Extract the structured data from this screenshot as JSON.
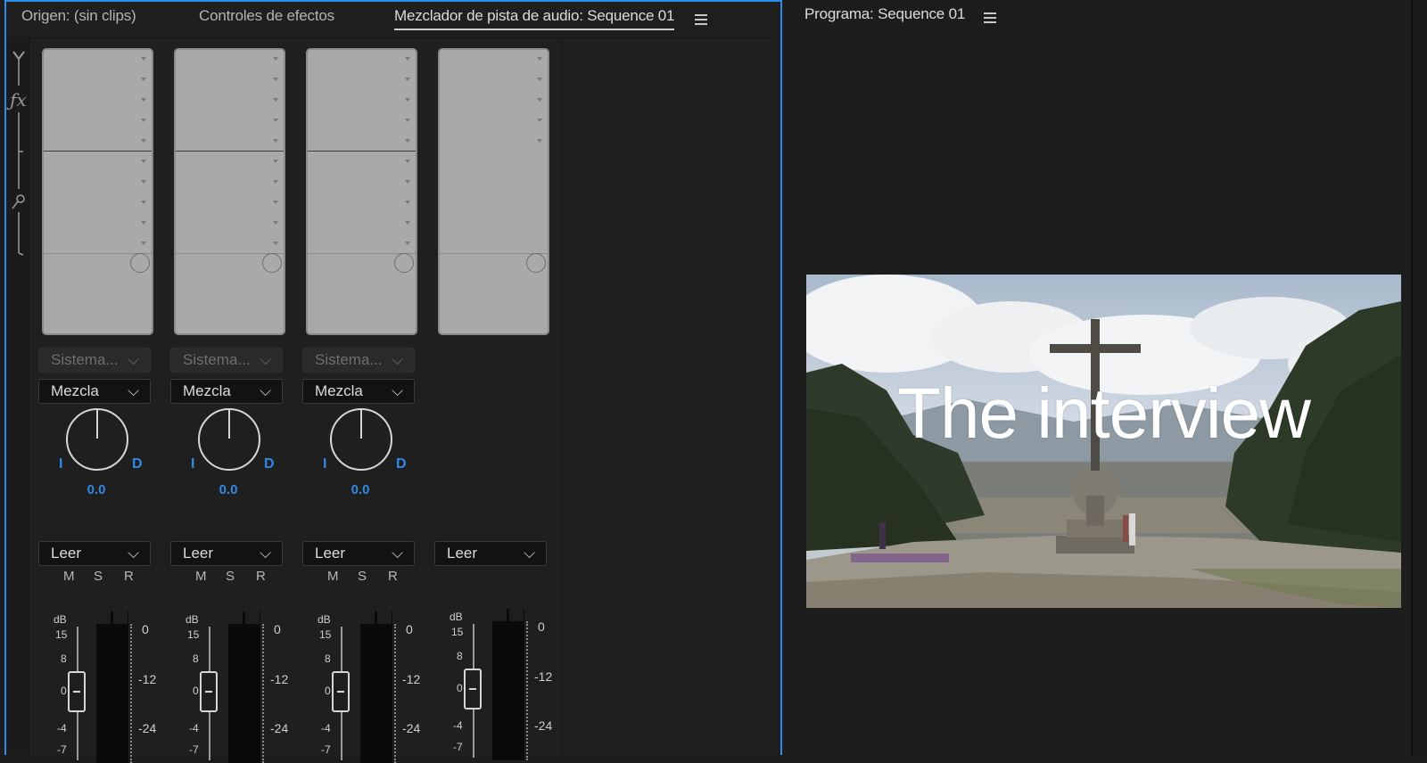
{
  "tabs": {
    "source": "Origen: (sin clips)",
    "effect_controls": "Controles de efectos",
    "audio_mixer": "Mezclador de pista de audio: Sequence 01",
    "program": "Programa: Sequence 01"
  },
  "strips": [
    {
      "input": "Sistema...",
      "routing": "Mezcla",
      "pan_left": "I",
      "pan_right": "D",
      "pan_value": "0.0",
      "automation": "Leer",
      "mute": "M",
      "solo": "S",
      "record": "R"
    },
    {
      "input": "Sistema...",
      "routing": "Mezcla",
      "pan_left": "I",
      "pan_right": "D",
      "pan_value": "0.0",
      "automation": "Leer",
      "mute": "M",
      "solo": "S",
      "record": "R"
    },
    {
      "input": "Sistema...",
      "routing": "Mezcla",
      "pan_left": "I",
      "pan_right": "D",
      "pan_value": "0.0",
      "automation": "Leer",
      "mute": "M",
      "solo": "S",
      "record": "R"
    },
    {
      "automation": "Leer"
    }
  ],
  "fader_scale": {
    "unit": "dB",
    "ticks": [
      "15",
      "8",
      "0",
      "-4",
      "-7"
    ]
  },
  "meter_scale": [
    "0",
    "-12",
    "-24"
  ],
  "program_monitor": {
    "title_text": "The interview"
  },
  "colors": {
    "accent_blue": "#2e8ae6",
    "panel_border": "#2d8ceb",
    "background": "#1d1d1d"
  },
  "icons": [
    "menu-icon",
    "fx-icon",
    "mic-icon",
    "chevron-down-icon"
  ]
}
